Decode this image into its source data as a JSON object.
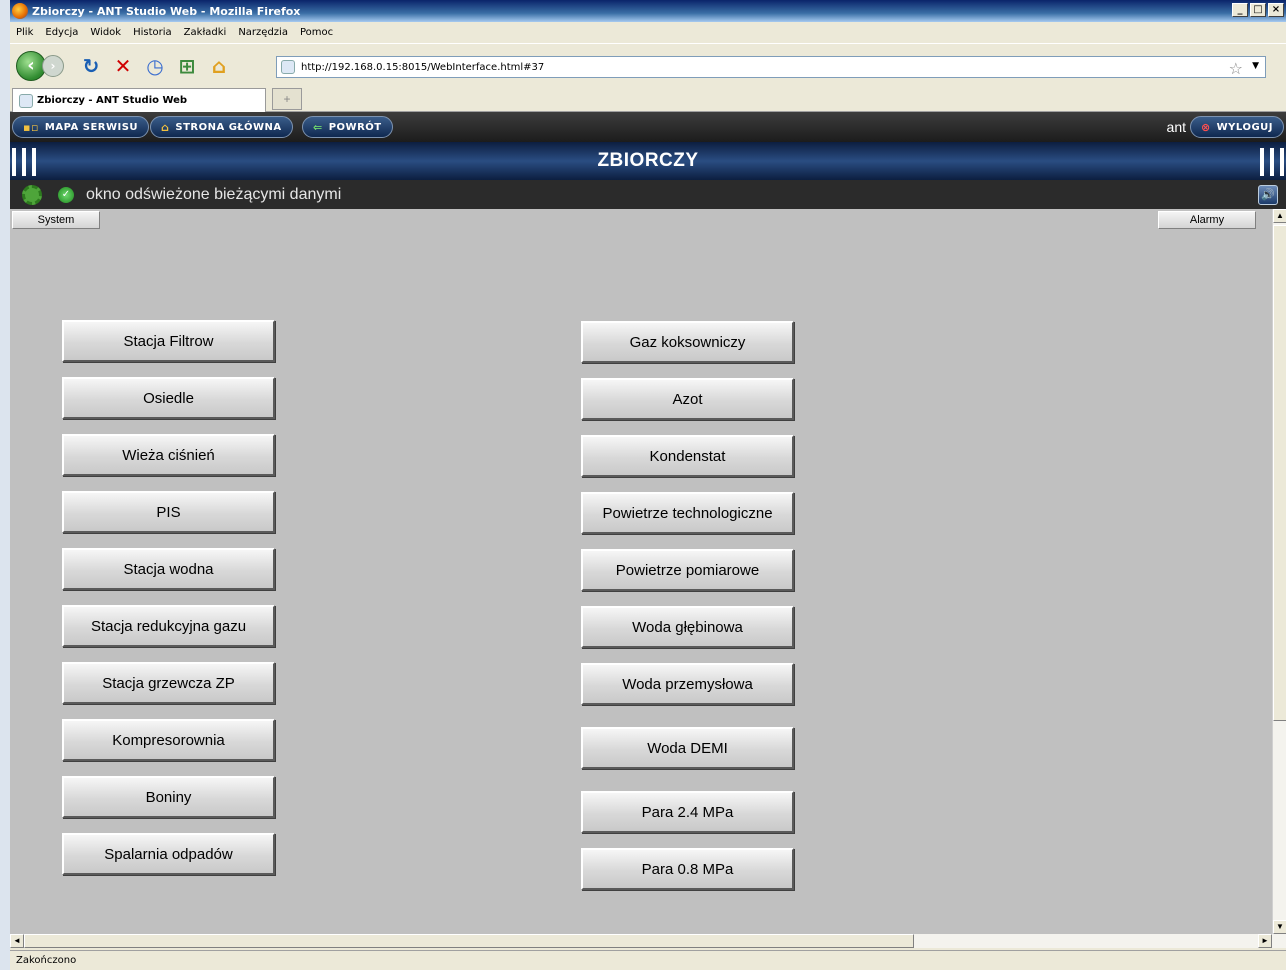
{
  "browser": {
    "window_title": "Zbiorczy - ANT Studio Web - Mozilla Firefox",
    "window_buttons": [
      "_",
      "□",
      "×"
    ],
    "menu": [
      "Plik",
      "Edycja",
      "Widok",
      "Historia",
      "Zakładki",
      "Narzędzia",
      "Pomoc"
    ],
    "url": "http://192.168.0.15:8015/WebInterface.html#37",
    "tab_title": "Zbiorczy - ANT Studio Web",
    "status_text": "Zakończono"
  },
  "app": {
    "nav": {
      "site_map": "MAPA SERWISU",
      "home": "STRONA GŁÓWNA",
      "back": "POWRÓT"
    },
    "user": "ant",
    "logout": "WYLOGUJ",
    "page_title": "ZBIORCZY",
    "status_message": "okno odświeżone bieżącymi danymi",
    "system_button": "System",
    "alarms_button": "Alarmy",
    "left_buttons": [
      "Stacja Filtrow",
      "Osiedle",
      "Wieża ciśnień",
      "PIS",
      "Stacja wodna",
      "Stacja redukcyjna gazu",
      "Stacja grzewcza ZP",
      "Kompresorownia",
      "Boniny",
      "Spalarnia odpadów"
    ],
    "right_buttons": [
      "Gaz koksowniczy",
      "Azot",
      "Kondenstat",
      "Powietrze technologiczne",
      "Powietrze pomiarowe",
      "Woda głębinowa",
      "Woda przemysłowa",
      "Woda DEMI",
      "Para 2.4 MPa",
      "Para 0.8 MPa"
    ]
  }
}
